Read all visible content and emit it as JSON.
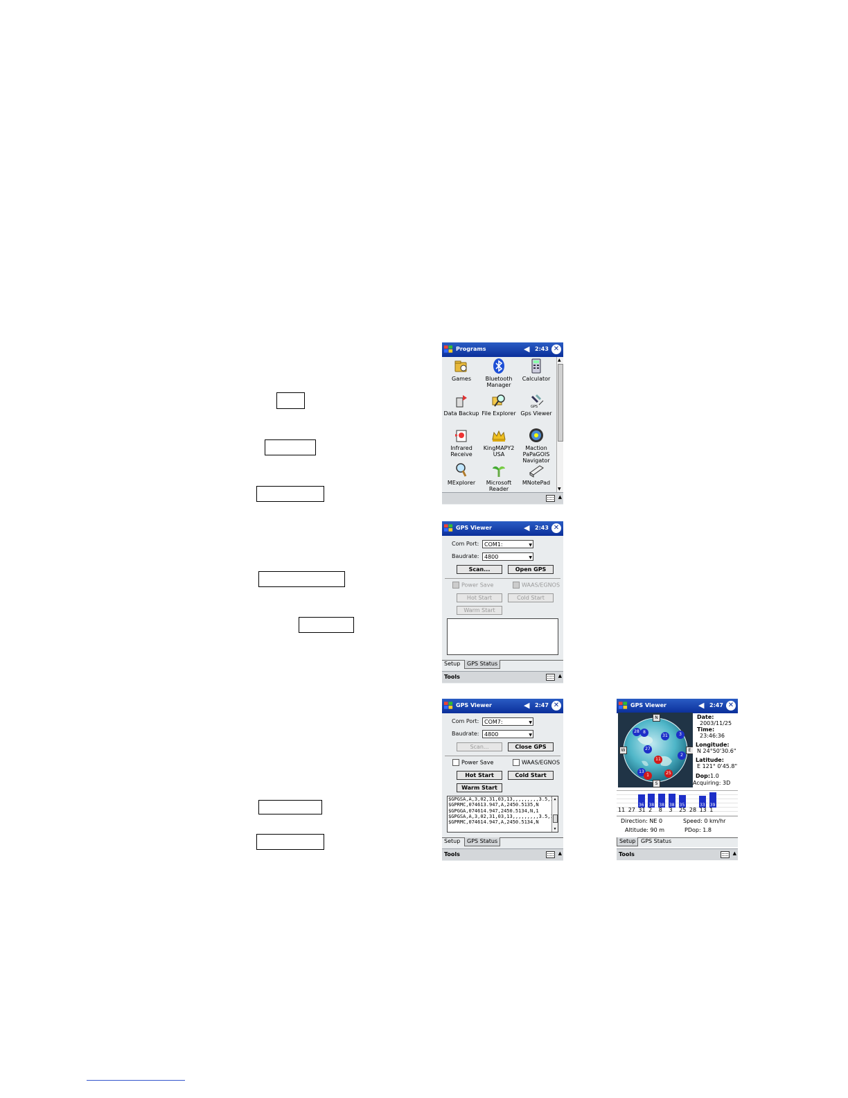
{
  "programs_screen": {
    "title": "Programs",
    "clock": "2:43",
    "items": [
      {
        "label": "Games",
        "icon": "games-icon"
      },
      {
        "label": "Bluetooth Manager",
        "icon": "bluetooth-icon"
      },
      {
        "label": "Calculator",
        "icon": "calculator-icon"
      },
      {
        "label": "Data Backup",
        "icon": "data-backup-icon"
      },
      {
        "label": "File Explorer",
        "icon": "file-explorer-icon"
      },
      {
        "label": "Gps Viewer",
        "icon": "gps-viewer-icon"
      },
      {
        "label": "Infrared Receive",
        "icon": "infrared-icon"
      },
      {
        "label": "KingMAPY2 USA",
        "icon": "crown-icon"
      },
      {
        "label": "Maction PaPaGOIS Navigator",
        "icon": "navigator-icon"
      },
      {
        "label": "MExplorer",
        "icon": "magnifier-icon"
      },
      {
        "label": "Microsoft Reader",
        "icon": "reader-icon"
      },
      {
        "label": "MNotePad",
        "icon": "notepad-icon"
      }
    ]
  },
  "gps_setup_1": {
    "title": "GPS Viewer",
    "clock": "2:43",
    "com_port_label": "Com Port:",
    "com_port_value": "COM1:",
    "baudrate_label": "Baudrate:",
    "baudrate_value": "4800",
    "scan_label": "Scan...",
    "open_label": "Open GPS",
    "power_save_label": "Power Save",
    "waas_label": "WAAS/EGNOS",
    "hot_start_label": "Hot Start",
    "cold_start_label": "Cold Start",
    "warm_start_label": "Warm Start",
    "tab_setup": "Setup",
    "tab_status": "GPS Status",
    "tools_label": "Tools"
  },
  "gps_setup_2": {
    "title": "GPS Viewer",
    "clock": "2:47",
    "com_port_label": "Com Port:",
    "com_port_value": "COM7:",
    "baudrate_label": "Baudrate:",
    "baudrate_value": "4800",
    "scan_label": "Scan...",
    "close_label": "Close GPS",
    "power_save_label": "Power Save",
    "waas_label": "WAAS/EGNOS",
    "hot_start_label": "Hot Start",
    "cold_start_label": "Cold Start",
    "warm_start_label": "Warm Start",
    "log_lines": [
      "$GPGSA,A,3,02,31,03,13,,,,,,,,,3.5,1",
      "$GPRMC,074613.947,A,2450.5135,N",
      "$GPGGA,074614.947,2450.5134,N,1",
      "$GPGSA,A,3,02,31,03,13,,,,,,,,,3.5,1",
      "$GPRMC,074614.947,A,2450.5134,N"
    ],
    "tab_setup": "Setup",
    "tab_status": "GPS Status",
    "tools_label": "Tools"
  },
  "gps_status": {
    "title": "GPS Viewer",
    "clock": "2:47",
    "date_label": "Date:",
    "date_value": "2003/11/25",
    "time_label": "Time:",
    "time_value": "23:46:36",
    "longitude_label": "Longitude:",
    "longitude_value": "N  24°50'30.6\"",
    "latitude_label": "Latitude:",
    "latitude_value": "E 121° 0'45.8\"",
    "dop_label": "Dop:",
    "dop_value": "1.0",
    "acquiring_text": "Acquiring: 3D",
    "compass": [
      "N",
      "E",
      "S",
      "W"
    ],
    "sky_sats": [
      {
        "id": "28",
        "color": "#1d2fc8"
      },
      {
        "id": "8",
        "color": "#1d2fc8"
      },
      {
        "id": "31",
        "color": "#1d2fc8"
      },
      {
        "id": "3",
        "color": "#1d2fc8"
      },
      {
        "id": "27",
        "color": "#1d2fc8"
      },
      {
        "id": "2",
        "color": "#1d2fc8"
      },
      {
        "id": "11",
        "color": "#d11a1a"
      },
      {
        "id": "13",
        "color": "#1d2fc8"
      },
      {
        "id": "1",
        "color": "#d11a1a"
      },
      {
        "id": "25",
        "color": "#d11a1a"
      }
    ],
    "signal_bars": [
      {
        "prn": "11",
        "value": "",
        "level": 0
      },
      {
        "prn": "27",
        "value": "36",
        "level": 0.8
      },
      {
        "prn": "31",
        "value": "38",
        "level": 0.85
      },
      {
        "prn": "2",
        "value": "38",
        "level": 0.85
      },
      {
        "prn": "8",
        "value": "38",
        "level": 0.85
      },
      {
        "prn": "3",
        "value": "35",
        "level": 0.75
      },
      {
        "prn": "25",
        "value": "",
        "level": 0
      },
      {
        "prn": "28",
        "value": "33",
        "level": 0.7
      },
      {
        "prn": "13",
        "value": "39",
        "level": 0.9
      },
      {
        "prn": "1",
        "value": "",
        "level": 0
      }
    ],
    "direction_label": "Direction:",
    "direction_value": "NE 0",
    "speed_label": "Speed:",
    "speed_value": "0 km/hr",
    "altitude_label": "Altitude:",
    "altitude_value": "90 m",
    "pdop_label": "PDop:",
    "pdop_value": "1.8",
    "tab_setup": "Setup",
    "tab_status": "GPS Status",
    "tools_label": "Tools"
  }
}
